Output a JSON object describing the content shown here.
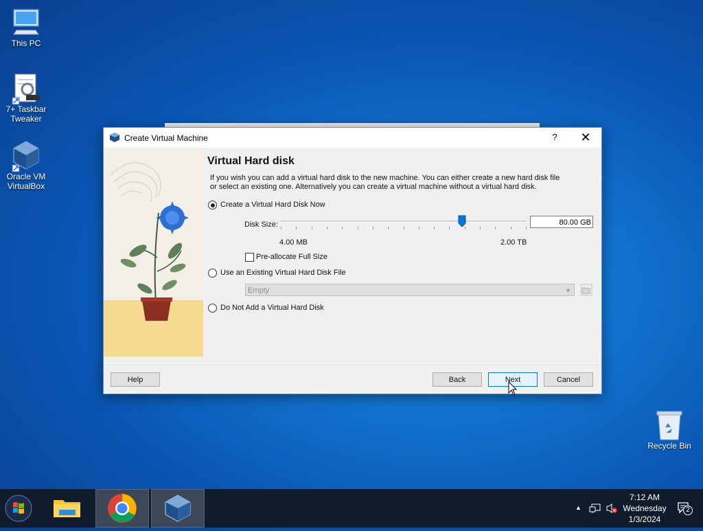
{
  "desktop": {
    "icons": [
      {
        "label": "This PC"
      },
      {
        "label": "7+ Taskbar Tweaker"
      },
      {
        "label": "Oracle VM VirtualBox"
      },
      {
        "label": "Recycle Bin"
      }
    ]
  },
  "dialog": {
    "title": "Create Virtual Machine",
    "help_glyph": "?",
    "close_glyph": "✕",
    "heading": "Virtual Hard disk",
    "description": "If you wish you can add a virtual hard disk to the new machine. You can either create a new hard disk file or select an existing one. Alternatively you can create a virtual machine without a virtual hard disk.",
    "options": {
      "create_new": {
        "label": "Create a Virtual Hard Disk Now",
        "selected": true
      },
      "use_existing": {
        "label": "Use an Existing Virtual Hard Disk File",
        "selected": false
      },
      "no_disk": {
        "label": "Do Not Add a Virtual Hard Disk",
        "selected": false
      }
    },
    "disk_size": {
      "label": "Disk Size:",
      "value": "80.00 GB",
      "min_label": "4.00 MB",
      "max_label": "2.00 TB",
      "slider_fraction": 0.74
    },
    "preallocate": {
      "label": "Pre-allocate Full Size",
      "checked": false
    },
    "existing_file": {
      "value": "Empty"
    },
    "buttons": {
      "help": "Help",
      "back": "Back",
      "next": "Next",
      "cancel": "Cancel"
    }
  },
  "taskbar": {
    "clock": {
      "time": "7:12 AM",
      "day": "Wednesday",
      "date": "1/3/2024"
    },
    "notification_count": "2",
    "tray_up_arrow": "▲"
  },
  "colors": {
    "accent": "#0078d7",
    "taskbar": "#101b2b"
  }
}
